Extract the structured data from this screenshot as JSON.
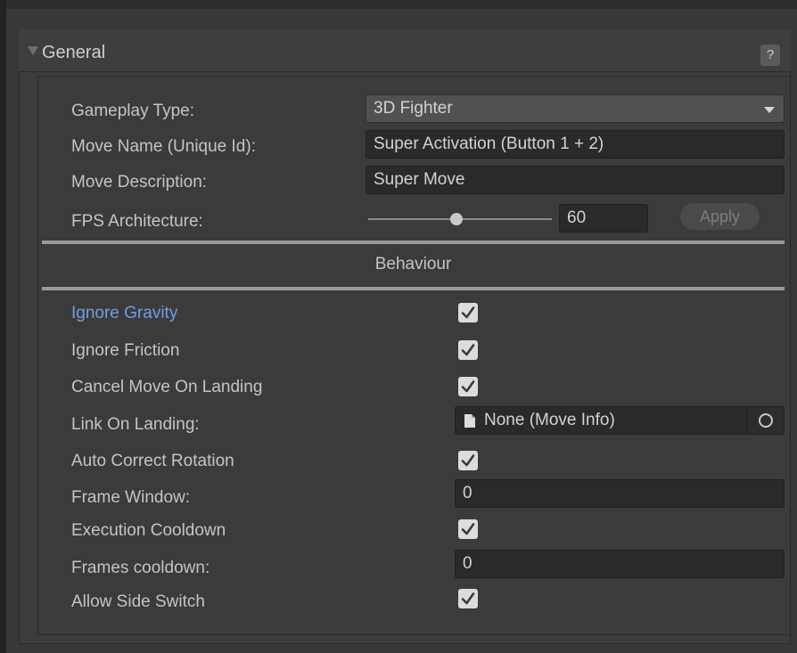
{
  "foldout": {
    "title": "General",
    "help_label": "?"
  },
  "general": {
    "gameplay_type_label": "Gameplay Type:",
    "gameplay_type_value": "3D Fighter",
    "move_name_label": "Move Name (Unique Id):",
    "move_name_value": "Super Activation (Button 1 + 2)",
    "move_description_label": "Move Description:",
    "move_description_value": "Super Move",
    "fps_label": "FPS Architecture:",
    "fps_value": "60",
    "apply_label": "Apply"
  },
  "behaviour": {
    "section_title": "Behaviour",
    "ignore_gravity_label": "Ignore Gravity",
    "ignore_gravity_checked": true,
    "ignore_friction_label": "Ignore Friction",
    "ignore_friction_checked": true,
    "cancel_move_on_landing_label": "Cancel Move On Landing",
    "cancel_move_on_landing_checked": true,
    "link_on_landing_label": "Link On Landing:",
    "link_on_landing_value": "None (Move Info)",
    "auto_correct_rotation_label": "Auto Correct Rotation",
    "auto_correct_rotation_checked": true,
    "frame_window_label": "Frame Window:",
    "frame_window_value": "0",
    "execution_cooldown_label": "Execution Cooldown",
    "execution_cooldown_checked": true,
    "frames_cooldown_label": "Frames cooldown:",
    "frames_cooldown_value": "0",
    "allow_side_switch_label": "Allow Side Switch",
    "allow_side_switch_checked": true
  },
  "colors": {
    "background": "#383838",
    "field_background": "#2a2a2a",
    "selected_label": "#6f9ee6",
    "text": "#c4c4c4"
  }
}
